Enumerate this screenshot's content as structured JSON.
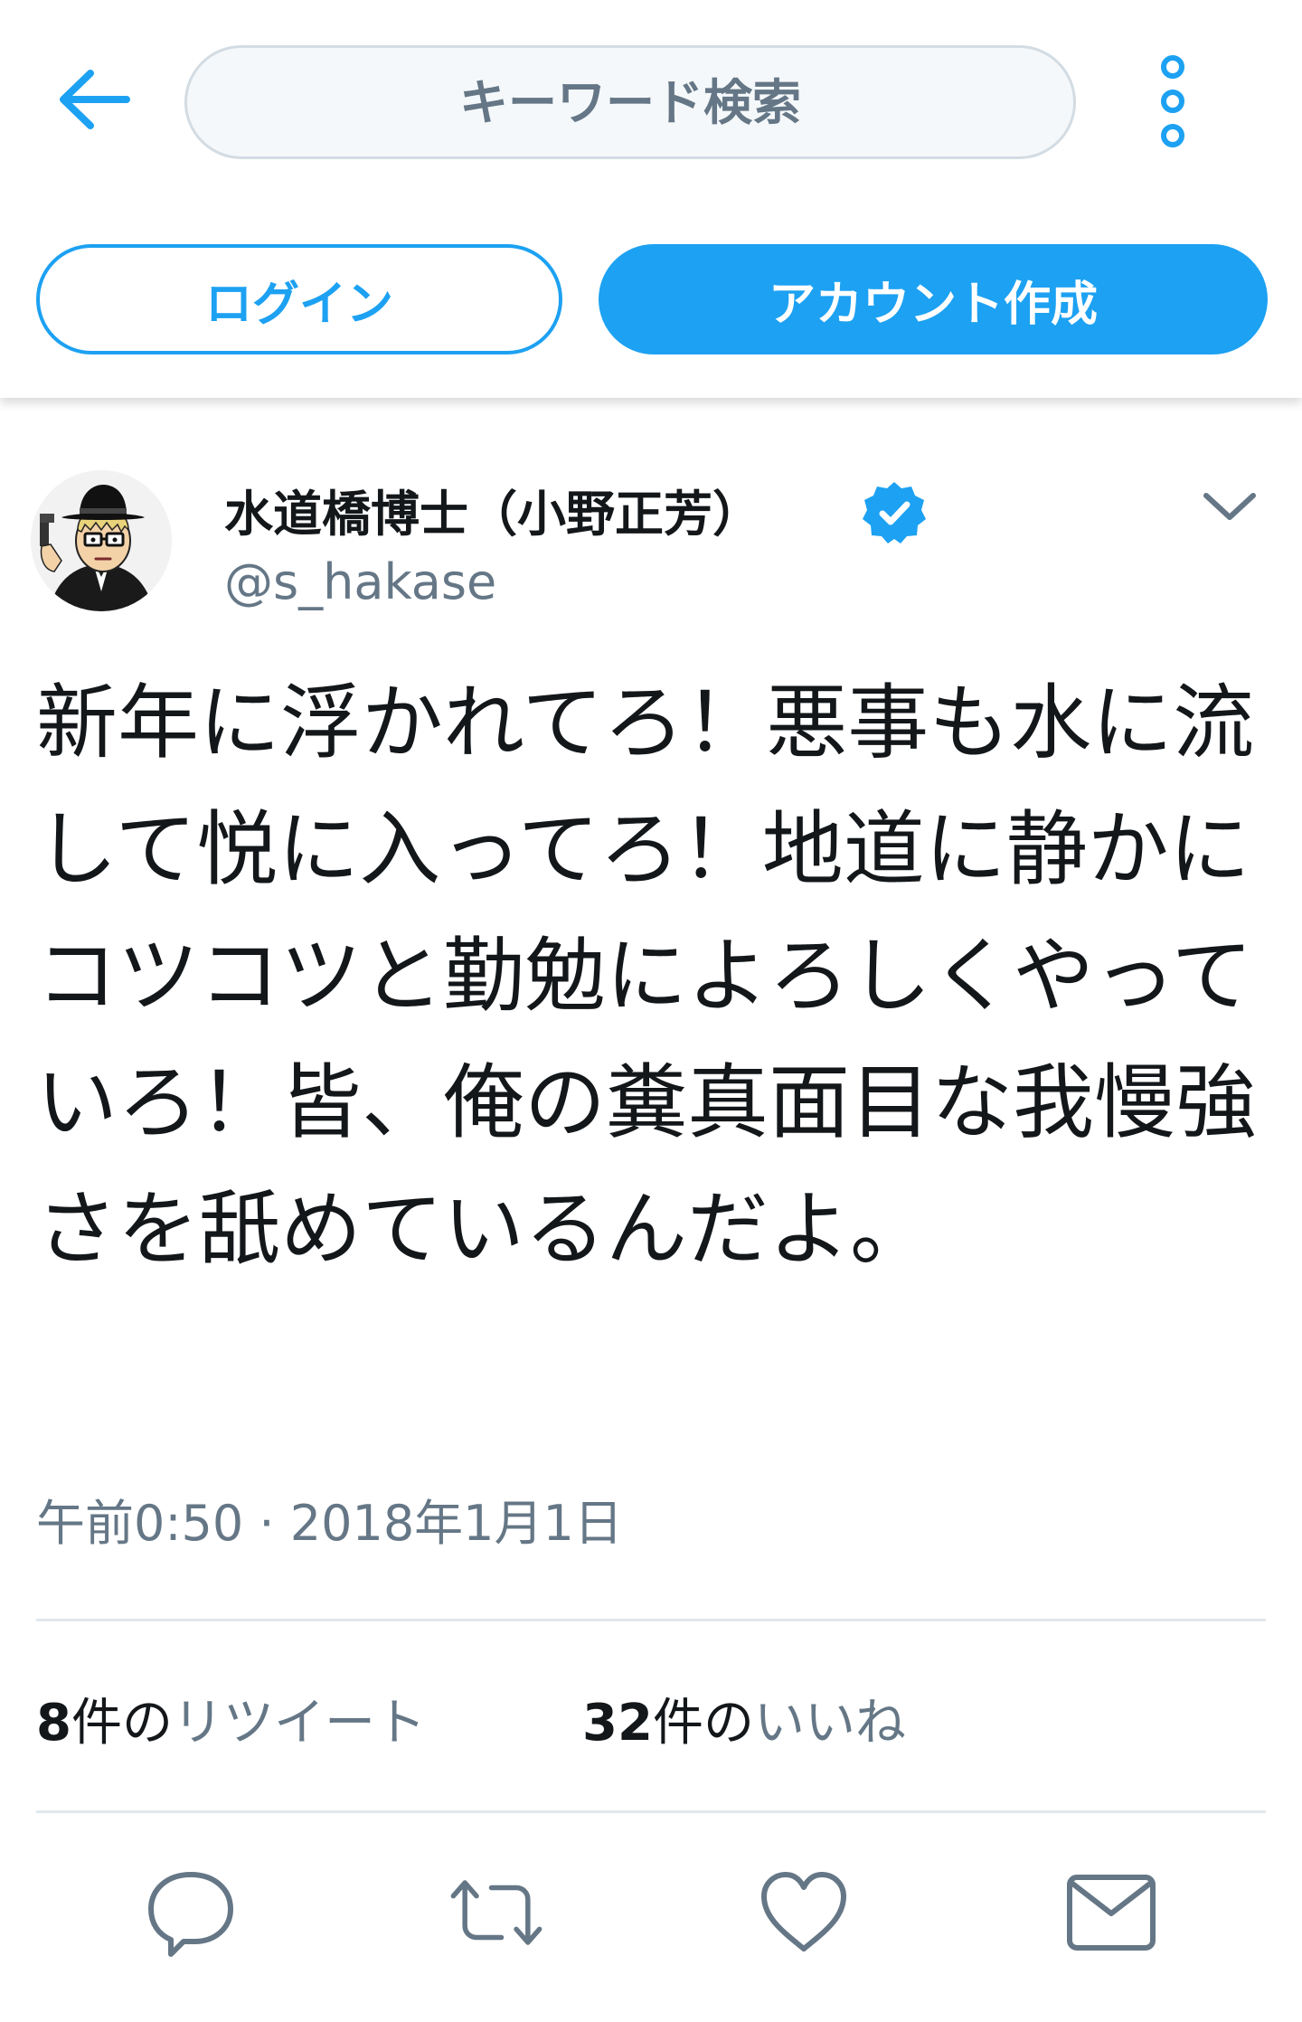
{
  "search": {
    "placeholder": "キーワード検索"
  },
  "auth": {
    "login_label": "ログイン",
    "signup_label": "アカウント作成"
  },
  "tweet": {
    "display_name": "水道橋博士（小野正芳）",
    "handle": "@s_hakase",
    "verified": true,
    "text": "新年に浮かれてろ！悪事も水に流して悦に入ってろ！地道に静かにコツコツと勤勉によろしくやっていろ！皆、俺の糞真面目な我慢強さを舐めているんだよ。",
    "timestamp": "午前0:50 · 2018年1月1日",
    "retweets": {
      "count": "8",
      "unit": "件の",
      "label": "リツイート"
    },
    "likes": {
      "count": "32",
      "unit": "件の",
      "label": "いいね"
    }
  },
  "icons": {
    "back": "arrow-left-icon",
    "more": "more-vertical-icon",
    "verified": "verified-badge-icon",
    "caret": "chevron-down-icon",
    "reply": "reply-icon",
    "retweet": "retweet-icon",
    "like": "heart-icon",
    "message": "mail-icon"
  },
  "colors": {
    "accent": "#1da1f2",
    "text": "#14171a",
    "secondary": "#657786",
    "divider": "#e1e8ed"
  }
}
